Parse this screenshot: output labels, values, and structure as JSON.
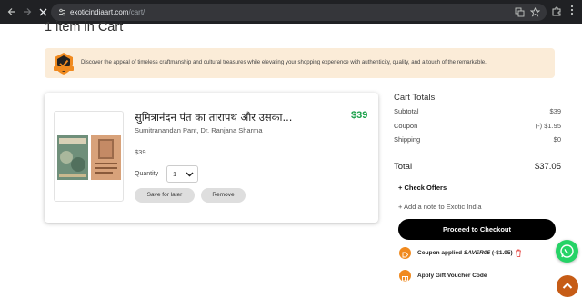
{
  "browser": {
    "url_host": "exoticindiaart.com",
    "url_path": "/cart/"
  },
  "page": {
    "title": "1 item in Cart"
  },
  "banner": {
    "text": "Discover the appeal of timeless craftmanship and cultural treasures while elevating your shopping experience with authenticity, quality, and a touch of the remarkable."
  },
  "cart_item": {
    "title": "सुमित्रानंदन पंत का तारापथ और उसका...",
    "authors": "Sumitranandan Pant, Dr. Ranjana Sharma",
    "price_highlight": "$39",
    "price": "$39",
    "quantity_label": "Quantity",
    "quantity_value": "1",
    "save_for_later_label": "Save for later",
    "remove_label": "Remove"
  },
  "totals": {
    "title": "Cart Totals",
    "subtotal_label": "Subtotal",
    "subtotal_value": "$39",
    "coupon_label": "Coupon",
    "coupon_value": "(-) $1.95",
    "shipping_label": "Shipping",
    "shipping_value": "$0",
    "total_label": "Total",
    "total_value": "$37.05"
  },
  "offers": {
    "check_offers_label": "+  Check Offers",
    "add_note_label": "+  Add a note to Exotic India",
    "checkout_label": "Proceed to Checkout",
    "coupon_applied_prefix": "Coupon applied ",
    "coupon_code": "SAVER05",
    "coupon_discount": " (-$1.95)",
    "voucher_label": "Apply Gift Voucher Code"
  },
  "colors": {
    "accent_green": "#1aa14a",
    "banner_bg": "#fbecd8",
    "orange": "#f08a1f",
    "whatsapp": "#25d366",
    "to_top": "#c65c16"
  }
}
